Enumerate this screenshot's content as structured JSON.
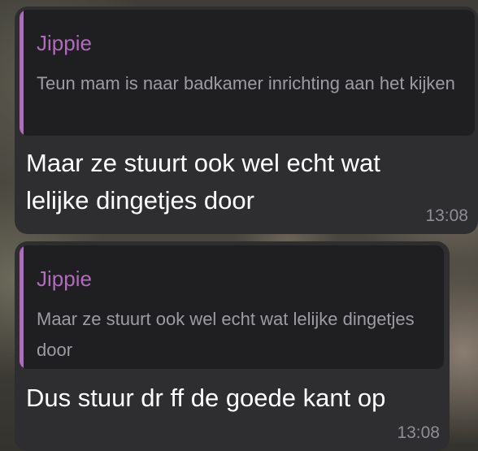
{
  "messages": [
    {
      "reply": {
        "author": "Jippie",
        "text": "Teun mam is naar badkamer inrichting aan het kijken"
      },
      "text": "Maar ze stuurt ook wel echt wat lelijke dingetjes door",
      "time": "13:08"
    },
    {
      "reply": {
        "author": "Jippie",
        "text": "Maar ze stuurt ook wel echt wat lelijke dingetjes door"
      },
      "text": "Dus stuur dr ff de goede kant op",
      "time": "13:08"
    }
  ],
  "colors": {
    "bubble": "#2e2e30",
    "quote_background": "#1f1f21",
    "quote_accent": "#b06bbd",
    "quote_text": "#9c9ca2",
    "message_text": "#ffffff",
    "timestamp": "#8e8e93"
  }
}
